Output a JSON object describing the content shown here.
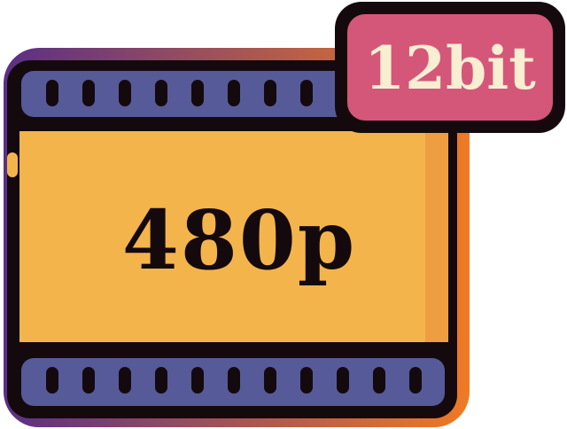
{
  "icon": {
    "resolution_label": "480p",
    "bitdepth_badge": "12bit",
    "colors": {
      "outline": "#140a0e",
      "glow_left": "#5a2f86",
      "glow_right": "#f07a24",
      "strip": "#575a98",
      "frame": "#f4b44c",
      "frame_shade": "#e98c38",
      "badge": "#d45779",
      "badge_text": "#f8eed2",
      "label_text": "#140a0e"
    }
  }
}
